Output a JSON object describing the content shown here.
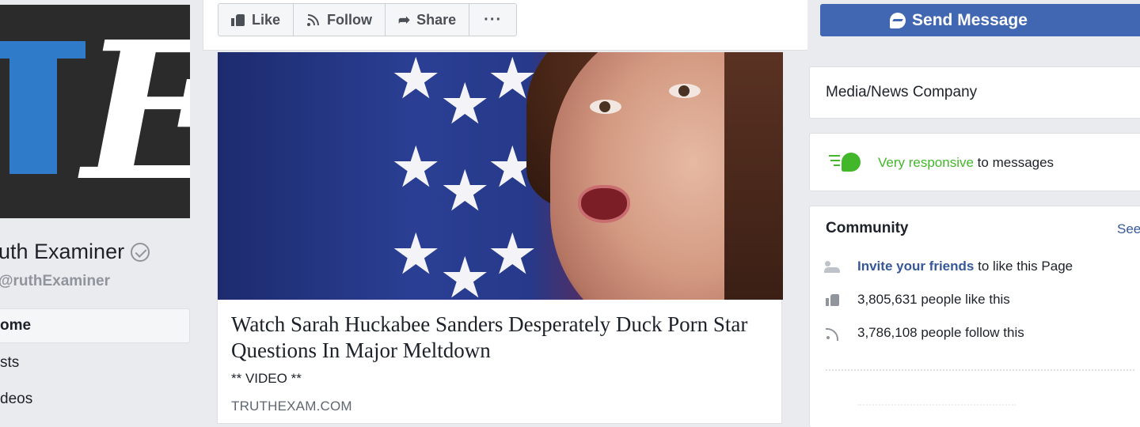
{
  "page": {
    "name": "uth Examiner",
    "handle": "ruthExaminer",
    "logo_text": "TE"
  },
  "nav": {
    "items": [
      {
        "label": "ome",
        "active": true
      },
      {
        "label": "sts",
        "active": false
      },
      {
        "label": "deos",
        "active": false
      }
    ]
  },
  "actions": {
    "like_label": "Like",
    "follow_label": "Follow",
    "share_label": "Share",
    "more_label": "···",
    "send_message_label": "Send Message"
  },
  "post": {
    "title": "Watch Sarah Huckabee Sanders Desperately Duck Porn Star Questions In Major Meltdown",
    "subtitle": "** VIDEO **",
    "domain": "TRUTHEXAM.COM"
  },
  "sidebar": {
    "category": "Media/News Company",
    "responsiveness": {
      "highlight": "Very responsive",
      "rest": " to messages"
    },
    "community": {
      "title": "Community",
      "see_all": "See",
      "invite_link": "Invite your friends",
      "invite_rest": " to like this Page",
      "likes_text": "3,805,631 people like this",
      "follows_text": "3,786,108 people follow this"
    }
  },
  "colors": {
    "brand_blue": "#4267b2",
    "link_blue": "#365899",
    "responsive_green": "#42b72a",
    "logo_blue": "#2f7ac9"
  }
}
